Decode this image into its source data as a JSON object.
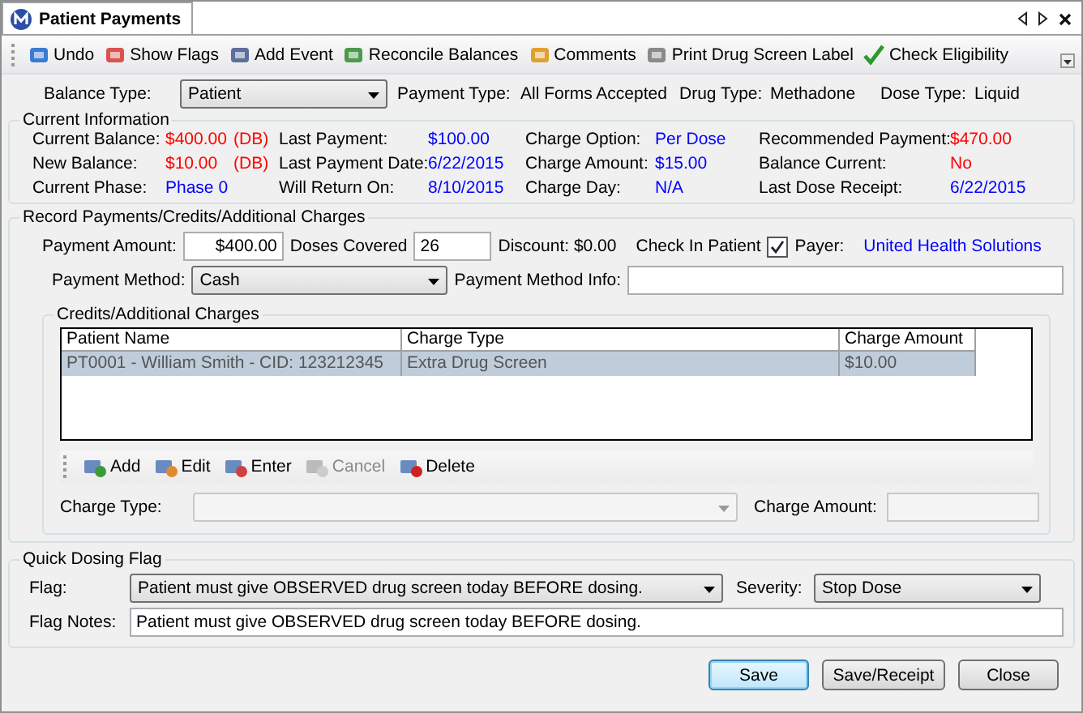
{
  "tab": {
    "title": "Patient Payments"
  },
  "toolbar": [
    {
      "label": "Undo"
    },
    {
      "label": "Show Flags"
    },
    {
      "label": "Add Event"
    },
    {
      "label": "Reconcile Balances"
    },
    {
      "label": "Comments"
    },
    {
      "label": "Print Drug Screen Label"
    },
    {
      "label": "Check Eligibility"
    }
  ],
  "summary": [
    {
      "label": "Balance Type:",
      "value": "Patient",
      "kind": "dropdown"
    },
    {
      "label": "Payment Type:",
      "value": "All Forms Accepted",
      "kind": "text"
    },
    {
      "label": "Drug Type:",
      "value": "Methadone",
      "kind": "text"
    },
    {
      "label": "Dose Type:",
      "value": "Liquid",
      "kind": "text"
    }
  ],
  "current_information": {
    "title": "Current Information",
    "items": [
      {
        "label": "Current Balance:",
        "value": "$400.00",
        "color": "#ff0000",
        "note": "(DB)"
      },
      {
        "label": "Last Payment:",
        "value": "$100.00",
        "color": "#0000ff"
      },
      {
        "label": "Charge Option:",
        "value": "Per Dose",
        "color": "#0000ff"
      },
      {
        "label": "Recommended Payment:",
        "value": "$470.00",
        "color": "#ff0000"
      },
      {
        "label": "New Balance:",
        "value": "$10.00",
        "color": "#ff0000",
        "note": "(DB)"
      },
      {
        "label": "Last Payment Date:",
        "value": "6/22/2015",
        "color": "#0000ff"
      },
      {
        "label": "Charge Amount:",
        "value": "$15.00",
        "color": "#0000ff"
      },
      {
        "label": "Balance Current:",
        "value": "No",
        "color": "#ff0000"
      },
      {
        "label": "Current Phase:",
        "value": "Phase 0",
        "color": "#0000ff"
      },
      {
        "label": "Will Return On:",
        "value": "8/10/2015",
        "color": "#0000ff"
      },
      {
        "label": "Charge Day:",
        "value": "N/A",
        "color": "#0000ff"
      },
      {
        "label": "Last Dose Receipt:",
        "value": "6/22/2015",
        "color": "#0000ff"
      }
    ]
  },
  "record": {
    "title": "Record Payments/Credits/Additional Charges",
    "payment_amount": {
      "label": "Payment Amount:",
      "value": "$400.00"
    },
    "doses_covered": {
      "label": "Doses Covered",
      "value": "26"
    },
    "discount": "Discount: $0.00",
    "check_in": {
      "label": "Check In Patient",
      "checked": true
    },
    "payer": {
      "label": "Payer:",
      "value": "United Health Solutions"
    },
    "payment_method": {
      "label": "Payment Method:",
      "value": "Cash"
    },
    "payment_method_info": {
      "label": "Payment Method Info:"
    },
    "credits": {
      "title": "Credits/Additional Charges",
      "columns": [
        "Patient Name",
        "Charge Type",
        "Charge Amount"
      ],
      "rows": [
        {
          "cells": [
            "PT0001 - William Smith - CID: 123212345",
            "Extra Drug Screen",
            "$10.00"
          ],
          "selected": true
        }
      ],
      "toolbar": [
        {
          "label": "Add",
          "disabled": false
        },
        {
          "label": "Edit",
          "disabled": false
        },
        {
          "label": "Enter",
          "disabled": false
        },
        {
          "label": "Cancel",
          "disabled": true
        },
        {
          "label": "Delete",
          "disabled": false
        }
      ],
      "charge_type": {
        "label": "Charge Type:"
      },
      "charge_amount": {
        "label": "Charge Amount:"
      }
    }
  },
  "quick_dosing_flag": {
    "title": "Quick Dosing Flag",
    "flag": {
      "label": "Flag:",
      "value": "Patient must give OBSERVED drug screen today BEFORE dosing."
    },
    "severity": {
      "label": "Severity:",
      "value": "Stop Dose"
    },
    "notes": {
      "label": "Flag Notes:",
      "value": "Patient must give OBSERVED drug screen today BEFORE dosing."
    }
  },
  "buttons": [
    {
      "label": "Save",
      "default": true
    },
    {
      "label": "Save/Receipt",
      "default": false
    },
    {
      "label": "Close",
      "default": false
    }
  ]
}
